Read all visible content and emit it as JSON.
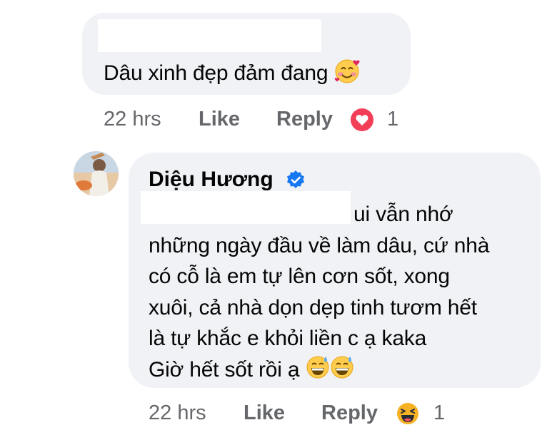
{
  "comment": {
    "text": "Dâu xinh đẹp đảm đang",
    "emoji": "smiling-face-with-hearts",
    "time": "22 hrs",
    "like_label": "Like",
    "reply_label": "Reply",
    "reaction": "love",
    "reaction_count": "1"
  },
  "reply": {
    "author": "Diệu Hương",
    "verified": true,
    "lines": [
      "ui vẫn nhớ",
      "những ngày đầu về làm dâu, cứ nhà",
      "có cỗ là em tự lên cơn sốt, xong",
      "xuôi, cả nhà dọn dẹp tinh tươm hết",
      "là tự khắc e khỏi liền c ạ kaka",
      "Giờ hết sốt rồi ạ"
    ],
    "emojis": [
      "grinning-face-with-sweat",
      "grinning-face-with-sweat"
    ],
    "time": "22 hrs",
    "like_label": "Like",
    "reply_label": "Reply",
    "reaction": "haha",
    "reaction_count": "1"
  },
  "colors": {
    "bubble": "#f0f2f5",
    "meta_text": "#65676b",
    "verified": "#1877f2",
    "love": "#f33e58",
    "haha": "#f7b125"
  }
}
